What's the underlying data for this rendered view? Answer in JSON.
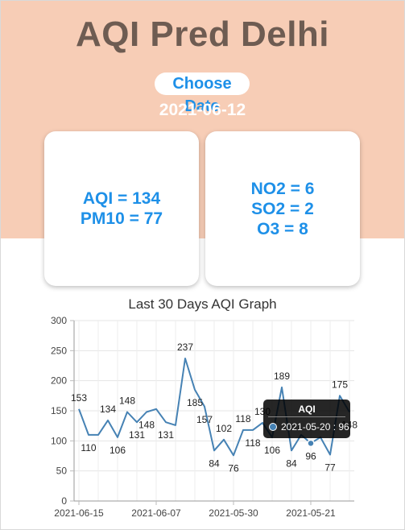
{
  "app": {
    "title": "AQI Pred Delhi",
    "choose_date_label": "Choose Date",
    "selected_date": "2021-06-12"
  },
  "cards": {
    "left": {
      "aqi": "AQI = 134",
      "pm10": "PM10 = 77"
    },
    "right": {
      "no2": "NO2 = 6",
      "so2": "SO2 = 2",
      "o3": "O3 = 8"
    }
  },
  "colors": {
    "header_bg": "#f7cdb6",
    "title": "#6e5c52",
    "accent": "#1e90e8",
    "line": "#4682b4"
  },
  "tooltip": {
    "title": "AQI",
    "text": "2021-05-20 : 96"
  },
  "chart_data": {
    "type": "line",
    "title": "Last 30 Days AQI Graph",
    "xlabel": "",
    "ylabel": "",
    "ylim": [
      0,
      300
    ],
    "yticks": [
      0,
      50,
      100,
      150,
      200,
      250,
      300
    ],
    "x_ticks_shown": [
      "2021-06-15",
      "2021-06-07",
      "2021-05-30",
      "2021-05-21"
    ],
    "grid": true,
    "series": [
      {
        "name": "AQI",
        "values": [
          153,
          110,
          110,
          134,
          106,
          148,
          131,
          148,
          153,
          131,
          126,
          237,
          185,
          157,
          84,
          102,
          76,
          118,
          118,
          130,
          106,
          189,
          84,
          110,
          96,
          106,
          77,
          175,
          148
        ],
        "labels_shown": {
          "0": "153",
          "1": "110",
          "3": "134",
          "4": "106",
          "5": "148",
          "6": "131",
          "7": "148",
          "9": "131",
          "11": "237",
          "12": "185",
          "13": "157",
          "14": "84",
          "15": "102",
          "16": "76",
          "17": "118",
          "18": "118",
          "19": "130",
          "20": "106",
          "21": "189",
          "22": "84",
          "24": "96",
          "26": "77",
          "27": "175",
          "28": "148"
        }
      }
    ]
  }
}
